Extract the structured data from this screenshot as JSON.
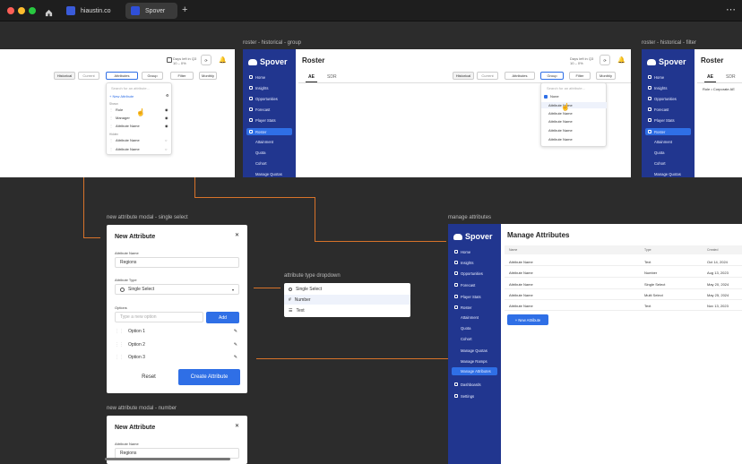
{
  "browser": {
    "tabs": [
      {
        "label": "hiaustin.co"
      },
      {
        "label": "Spover"
      }
    ],
    "new_tab": "+",
    "menu": "⋯"
  },
  "frames": {
    "roster_group": {
      "label": "roster - historical - group"
    },
    "roster_filter": {
      "label": "roster - historical - filter"
    },
    "modal_single": {
      "label": "new attribute modal - single select"
    },
    "type_dropdown": {
      "label": "attribute type dropdown"
    },
    "manage": {
      "label": "manage attributes"
    },
    "modal_number": {
      "label": "new attribute modal - number"
    }
  },
  "app": {
    "brand": "Spover",
    "nav": [
      "Home",
      "Insights",
      "Opportunities",
      "Forecast",
      "Player Stats",
      "Roster",
      "Attainment",
      "Quota",
      "Cohort",
      "Manage Quotas"
    ],
    "manage_nav": [
      "Home",
      "Insights",
      "Opportunities",
      "Forecast",
      "Player Stats",
      "Roster",
      "Attainment",
      "Quota",
      "Cohort",
      "Manage Quotas",
      "Manage Ramps",
      "Manage Attributes",
      "Dashboards",
      "Settings"
    ]
  },
  "roster": {
    "title": "Roster",
    "tabs": [
      "AE",
      "SDR"
    ],
    "toolbar": {
      "historical": "Historical",
      "current": "Current",
      "attributes": "Attributes",
      "group": "Group",
      "filter": "Filter",
      "monthly": "Monthly"
    },
    "date": {
      "line1": "Days left in Q3",
      "line2": "10 – 0%"
    },
    "filter_hint": "Role • Corporate AE"
  },
  "attr_panel": {
    "search": "Search for an attribute...",
    "new": "+ New Attribute",
    "shown_label": "Shown",
    "shown": [
      "Role",
      "Manager",
      "Attribute Name"
    ],
    "hidden_label": "Hidden",
    "hidden": [
      "Attribute Name",
      "Attribute Name"
    ]
  },
  "group_panel": {
    "search": "Search for an attribute...",
    "items": [
      "None",
      "Attribute Name",
      "Attribute Name",
      "Attribute Name",
      "Attribute Name",
      "Attribute Name"
    ]
  },
  "modal": {
    "title": "New Attribute",
    "name_label": "Attribute Name",
    "name_value": "Regions",
    "type_label": "Attribute Type",
    "type_value": "Single Select",
    "options_label": "Options",
    "option_placeholder": "Type a new option",
    "add": "Add",
    "options": [
      "Option 1",
      "Option 2",
      "Option 3"
    ],
    "reset": "Reset",
    "create": "Create Attribute",
    "close": "✕"
  },
  "type_dropdown": {
    "items": [
      "Single Select",
      "Number",
      "Text"
    ]
  },
  "manage": {
    "title": "Manage Attributes",
    "columns": [
      "Name",
      "Type",
      "Created"
    ],
    "rows": [
      [
        "Attribute Name",
        "Text",
        "Oct 14, 2024"
      ],
      [
        "Attribute Name",
        "Number",
        "Aug 13, 2023"
      ],
      [
        "Attribute Name",
        "Single Select",
        "May 20, 2024"
      ],
      [
        "Attribute Name",
        "Multi Select",
        "May 25, 2024"
      ],
      [
        "Attribute Name",
        "Text",
        "Nov 13, 2023"
      ]
    ],
    "new_button": "+ New Attribute"
  },
  "colors": {
    "brand": "#21368f",
    "accent": "#2f6fe6",
    "connector": "#d8732a"
  }
}
